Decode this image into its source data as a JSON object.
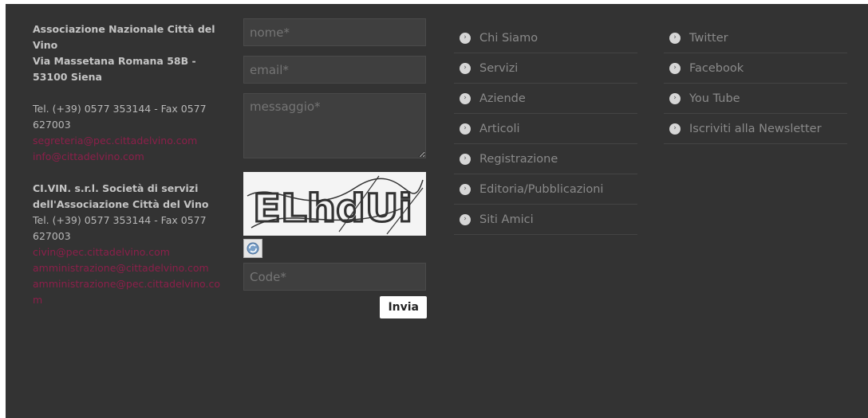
{
  "contact": {
    "org1_name": "Associazione Nazionale Città del Vino",
    "org1_address": "Via Massetana Romana 58B - 53100 Siena",
    "org1_phone": "Tel. (+39) 0577 353144 - Fax 0577 627003",
    "org1_email1": "segreteria@pec.cittadelvino.com",
    "org1_email2": "info@cittadelvino.com",
    "org2_name": "CI.VIN. s.r.l. Società di servizi dell'Associazione Città del Vino",
    "org2_phone": "Tel. (+39) 0577 353144 - Fax 0577 627003",
    "org2_email1": "civin@pec.cittadelvino.com",
    "org2_email2": "amministrazione@cittadelvino.com",
    "org2_email3": "amministrazione@pec.cittadelvino.com"
  },
  "form": {
    "name_placeholder": "nome*",
    "email_placeholder": "email*",
    "message_placeholder": "messaggio*",
    "captcha_text": "ELhdUi",
    "code_placeholder": "Code*",
    "submit_label": "Invia"
  },
  "menu1": [
    "Chi Siamo",
    "Servizi",
    "Aziende",
    "Articoli",
    "Registrazione",
    "Editoria/Pubblicazioni",
    "Siti Amici"
  ],
  "menu2": [
    "Twitter",
    "Facebook",
    "You Tube",
    "Iscriviti alla Newsletter"
  ],
  "colors": {
    "background": "#333333",
    "link": "#8c1f4a"
  }
}
